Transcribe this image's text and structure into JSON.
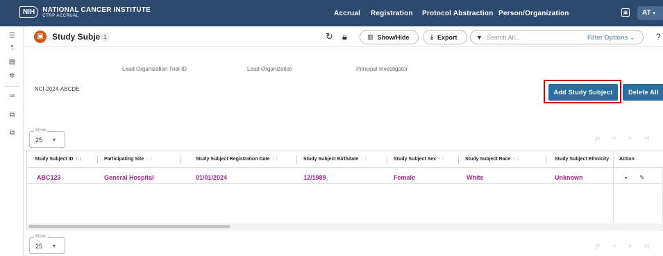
{
  "app": {
    "logo_abbr": "NIH",
    "institute": "NATIONAL CANCER INSTITUTE",
    "subtitle": "CTRP ACCRUAL"
  },
  "nav": {
    "items": [
      "Accrual",
      "Registration",
      "Protocol Abstraction",
      "Person/Organization"
    ],
    "user_initials": "AT"
  },
  "page": {
    "title": "Study Subject",
    "count": "1",
    "show_hide_label": "Show/Hide",
    "export_label": "Export",
    "search_placeholder": "Search All...",
    "filter_label": "Filter Options",
    "help_label": "?"
  },
  "trial": {
    "trial_id": "NCI-2024-ABCDE",
    "lead_org_trial_id_label": "Lead Organization Trial ID",
    "lead_org_label": "Lead Organization",
    "pi_label": "Principal Investigator"
  },
  "actions": {
    "add_label": "Add Study Subject",
    "delete_all_label": "Delete All"
  },
  "pagination": {
    "show_label": "Show",
    "page_size": "25",
    "first": "|<",
    "prev": "<",
    "next": ">",
    "last": ">|"
  },
  "table": {
    "columns": [
      "Study Subject ID",
      "Participating Site",
      "Study Subject Registration Date",
      "Study Subject Birthdate",
      "Study Subject Sex",
      "Study Subject Race",
      "Study Subject Ethnicity",
      "Action"
    ],
    "rows": [
      {
        "id": "ABC123",
        "site": "General Hospital",
        "reg_date": "01/01/2024",
        "birthdate": "12/1989",
        "sex": "Female",
        "race": "White",
        "ethnicity": "Unknown"
      }
    ]
  },
  "colors": {
    "header_bg": "#2d4a6e",
    "primary_button": "#2a6fa0",
    "link_text": "#a32486",
    "highlight_outline": "#d50000",
    "subject_icon": "#c85a1a"
  }
}
